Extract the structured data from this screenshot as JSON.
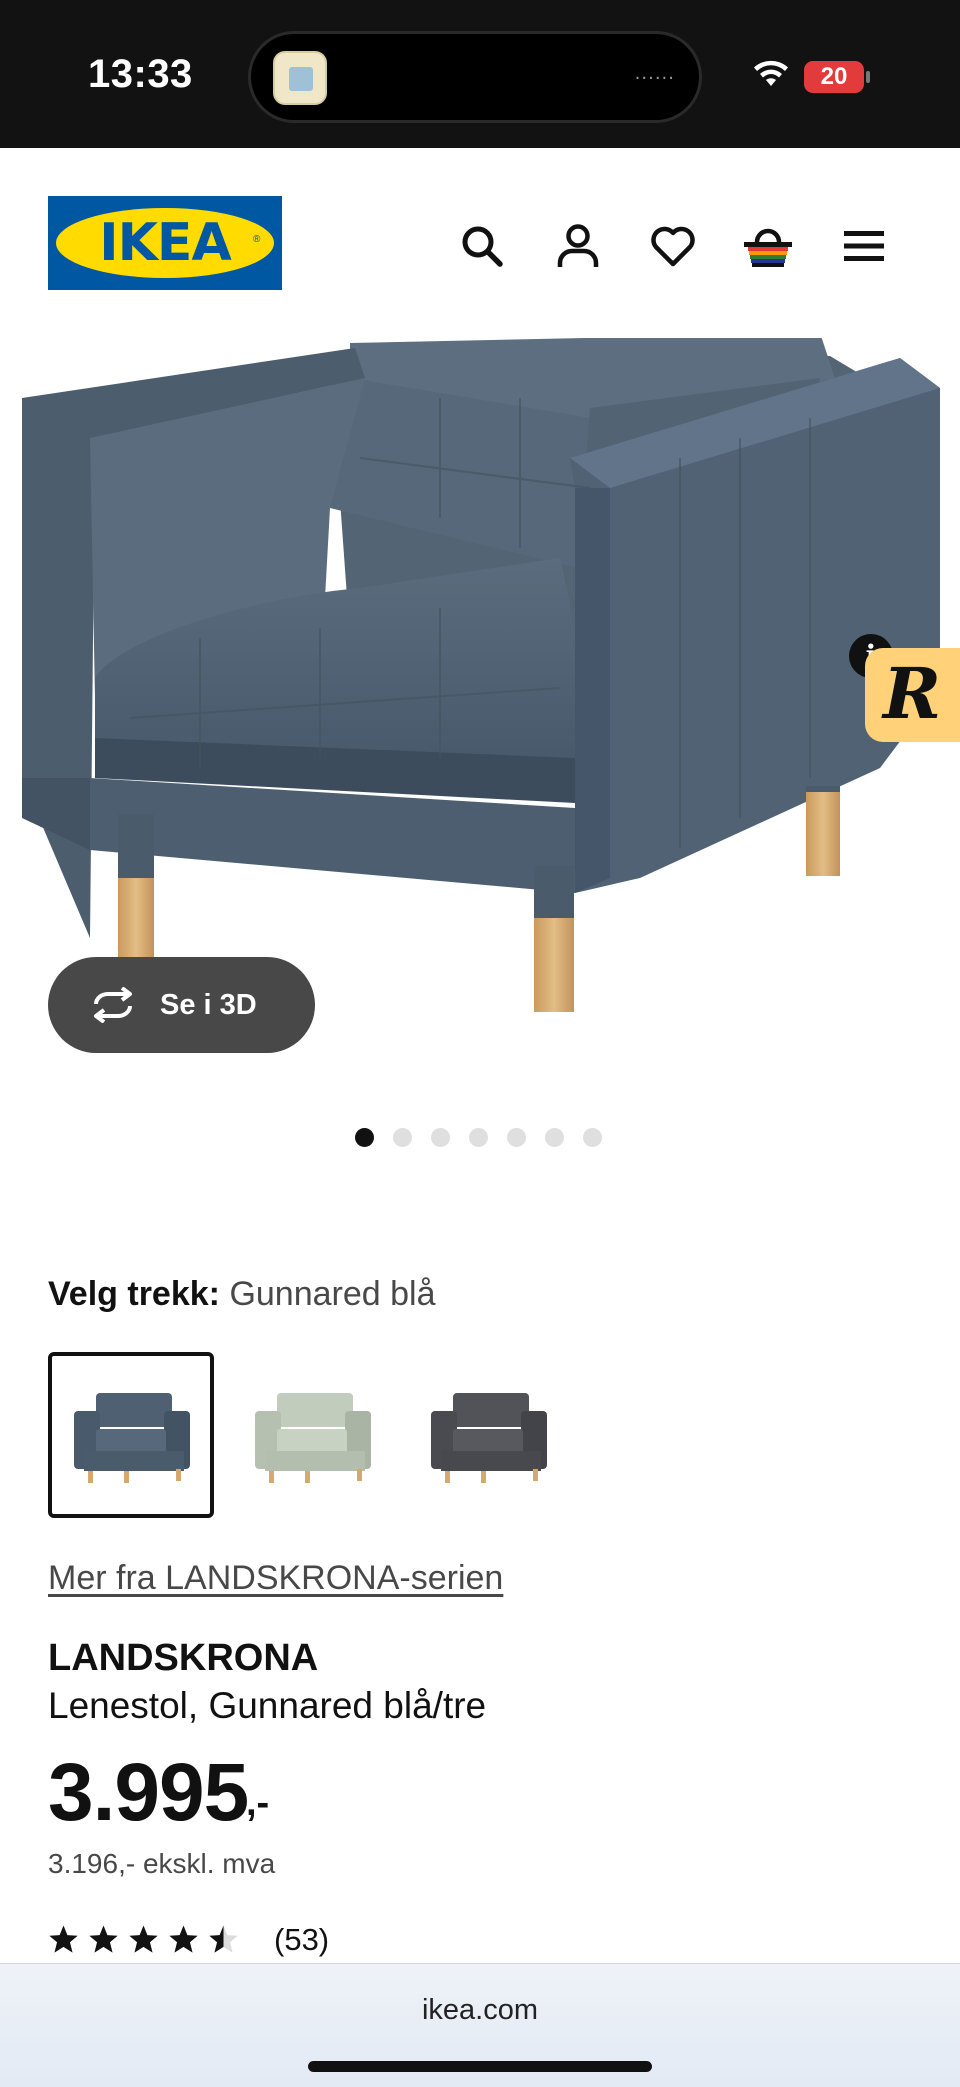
{
  "status_bar": {
    "time": "13:33",
    "battery": "20",
    "island_dots": "······"
  },
  "header": {
    "logo_text": "IKEA",
    "logo_reg": "®",
    "icons": [
      "search-icon",
      "account-icon",
      "heart-icon",
      "basket-icon",
      "menu-icon"
    ],
    "brand_colors": {
      "blue": "#0058a3",
      "yellow": "#ffdb00"
    }
  },
  "gallery": {
    "view_3d_label": "Se i 3D",
    "image_count": 7,
    "active_index": 0,
    "badge_letter": "R",
    "badge_info": "i"
  },
  "variant": {
    "label": "Velg trekk:",
    "value": "Gunnared blå",
    "options": [
      {
        "name": "Gunnared blå",
        "color": "#4a5a6a",
        "selected": true
      },
      {
        "name": "light green",
        "color": "#b8c2b2",
        "selected": false
      },
      {
        "name": "dark grey",
        "color": "#4c4d52",
        "selected": false
      }
    ]
  },
  "series_link": "Mer fra LANDSKRONA-serien",
  "product": {
    "brand": "LANDSKRONA",
    "description": "Lenestol, Gunnared blå/tre",
    "price": "3.995",
    "price_suffix": ",-",
    "price_ex_vat": "3.196,- ekskl. mva",
    "rating": 4.5,
    "review_count": "(53)"
  },
  "browser": {
    "url": "ikea.com"
  }
}
